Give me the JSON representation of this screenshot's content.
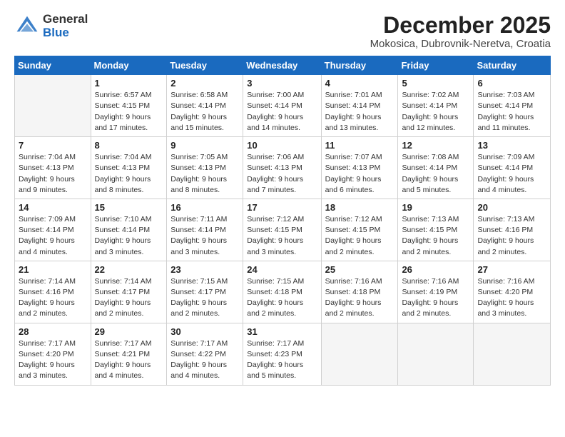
{
  "logo": {
    "general": "General",
    "blue": "Blue"
  },
  "title": {
    "month": "December 2025",
    "location": "Mokosica, Dubrovnik-Neretva, Croatia"
  },
  "weekdays": [
    "Sunday",
    "Monday",
    "Tuesday",
    "Wednesday",
    "Thursday",
    "Friday",
    "Saturday"
  ],
  "weeks": [
    [
      {
        "day": "",
        "info": ""
      },
      {
        "day": "1",
        "info": "Sunrise: 6:57 AM\nSunset: 4:15 PM\nDaylight: 9 hours\nand 17 minutes."
      },
      {
        "day": "2",
        "info": "Sunrise: 6:58 AM\nSunset: 4:14 PM\nDaylight: 9 hours\nand 15 minutes."
      },
      {
        "day": "3",
        "info": "Sunrise: 7:00 AM\nSunset: 4:14 PM\nDaylight: 9 hours\nand 14 minutes."
      },
      {
        "day": "4",
        "info": "Sunrise: 7:01 AM\nSunset: 4:14 PM\nDaylight: 9 hours\nand 13 minutes."
      },
      {
        "day": "5",
        "info": "Sunrise: 7:02 AM\nSunset: 4:14 PM\nDaylight: 9 hours\nand 12 minutes."
      },
      {
        "day": "6",
        "info": "Sunrise: 7:03 AM\nSunset: 4:14 PM\nDaylight: 9 hours\nand 11 minutes."
      }
    ],
    [
      {
        "day": "7",
        "info": "Sunrise: 7:04 AM\nSunset: 4:13 PM\nDaylight: 9 hours\nand 9 minutes."
      },
      {
        "day": "8",
        "info": "Sunrise: 7:04 AM\nSunset: 4:13 PM\nDaylight: 9 hours\nand 8 minutes."
      },
      {
        "day": "9",
        "info": "Sunrise: 7:05 AM\nSunset: 4:13 PM\nDaylight: 9 hours\nand 8 minutes."
      },
      {
        "day": "10",
        "info": "Sunrise: 7:06 AM\nSunset: 4:13 PM\nDaylight: 9 hours\nand 7 minutes."
      },
      {
        "day": "11",
        "info": "Sunrise: 7:07 AM\nSunset: 4:13 PM\nDaylight: 9 hours\nand 6 minutes."
      },
      {
        "day": "12",
        "info": "Sunrise: 7:08 AM\nSunset: 4:14 PM\nDaylight: 9 hours\nand 5 minutes."
      },
      {
        "day": "13",
        "info": "Sunrise: 7:09 AM\nSunset: 4:14 PM\nDaylight: 9 hours\nand 4 minutes."
      }
    ],
    [
      {
        "day": "14",
        "info": "Sunrise: 7:09 AM\nSunset: 4:14 PM\nDaylight: 9 hours\nand 4 minutes."
      },
      {
        "day": "15",
        "info": "Sunrise: 7:10 AM\nSunset: 4:14 PM\nDaylight: 9 hours\nand 3 minutes."
      },
      {
        "day": "16",
        "info": "Sunrise: 7:11 AM\nSunset: 4:14 PM\nDaylight: 9 hours\nand 3 minutes."
      },
      {
        "day": "17",
        "info": "Sunrise: 7:12 AM\nSunset: 4:15 PM\nDaylight: 9 hours\nand 3 minutes."
      },
      {
        "day": "18",
        "info": "Sunrise: 7:12 AM\nSunset: 4:15 PM\nDaylight: 9 hours\nand 2 minutes."
      },
      {
        "day": "19",
        "info": "Sunrise: 7:13 AM\nSunset: 4:15 PM\nDaylight: 9 hours\nand 2 minutes."
      },
      {
        "day": "20",
        "info": "Sunrise: 7:13 AM\nSunset: 4:16 PM\nDaylight: 9 hours\nand 2 minutes."
      }
    ],
    [
      {
        "day": "21",
        "info": "Sunrise: 7:14 AM\nSunset: 4:16 PM\nDaylight: 9 hours\nand 2 minutes."
      },
      {
        "day": "22",
        "info": "Sunrise: 7:14 AM\nSunset: 4:17 PM\nDaylight: 9 hours\nand 2 minutes."
      },
      {
        "day": "23",
        "info": "Sunrise: 7:15 AM\nSunset: 4:17 PM\nDaylight: 9 hours\nand 2 minutes."
      },
      {
        "day": "24",
        "info": "Sunrise: 7:15 AM\nSunset: 4:18 PM\nDaylight: 9 hours\nand 2 minutes."
      },
      {
        "day": "25",
        "info": "Sunrise: 7:16 AM\nSunset: 4:18 PM\nDaylight: 9 hours\nand 2 minutes."
      },
      {
        "day": "26",
        "info": "Sunrise: 7:16 AM\nSunset: 4:19 PM\nDaylight: 9 hours\nand 2 minutes."
      },
      {
        "day": "27",
        "info": "Sunrise: 7:16 AM\nSunset: 4:20 PM\nDaylight: 9 hours\nand 3 minutes."
      }
    ],
    [
      {
        "day": "28",
        "info": "Sunrise: 7:17 AM\nSunset: 4:20 PM\nDaylight: 9 hours\nand 3 minutes."
      },
      {
        "day": "29",
        "info": "Sunrise: 7:17 AM\nSunset: 4:21 PM\nDaylight: 9 hours\nand 4 minutes."
      },
      {
        "day": "30",
        "info": "Sunrise: 7:17 AM\nSunset: 4:22 PM\nDaylight: 9 hours\nand 4 minutes."
      },
      {
        "day": "31",
        "info": "Sunrise: 7:17 AM\nSunset: 4:23 PM\nDaylight: 9 hours\nand 5 minutes."
      },
      {
        "day": "",
        "info": ""
      },
      {
        "day": "",
        "info": ""
      },
      {
        "day": "",
        "info": ""
      }
    ]
  ]
}
